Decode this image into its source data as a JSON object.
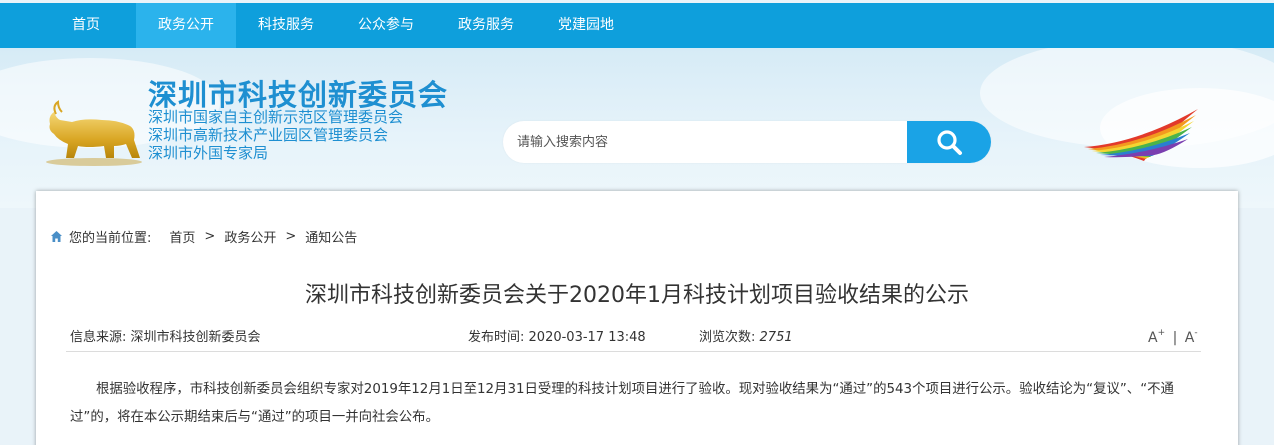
{
  "nav": {
    "items": [
      {
        "label": "首页",
        "active": false
      },
      {
        "label": "政务公开",
        "active": true
      },
      {
        "label": "科技服务",
        "active": false
      },
      {
        "label": "公众参与",
        "active": false
      },
      {
        "label": "政务服务",
        "active": false
      },
      {
        "label": "党建园地",
        "active": false
      }
    ]
  },
  "header": {
    "org_name": "深圳市科技创新委员会",
    "sub_names": [
      "深圳市国家自主创新示范区管理委员会",
      "深圳市高新技术产业园区管理委员会",
      "深圳市外国专家局"
    ]
  },
  "search": {
    "placeholder": "请输入搜索内容",
    "value": ""
  },
  "breadcrumb": {
    "prefix": "您的当前位置:",
    "items": [
      "首页",
      "政务公开",
      "通知公告"
    ],
    "separator": ">"
  },
  "article": {
    "title": "深圳市科技创新委员会关于2020年1月科技计划项目验收结果的公示",
    "source_label": "信息来源:",
    "source_value": "深圳市科技创新委员会",
    "publish_label": "发布时间:",
    "publish_value": "2020-03-17 13:48",
    "views_label": "浏览次数:",
    "views_value": "2751",
    "font_larger": "A",
    "font_smaller": "A",
    "font_larger_sup": "+",
    "font_smaller_sup": "-",
    "font_divider": "|",
    "paragraph": "根据验收程序，市科技创新委员会组织专家对2019年12月1日至12月31日受理的科技计划项目进行了验收。现对验收结果为“通过”的543个项目进行公示。验收结论为“复议”、“不通过”的，将在本公示期结束后与“通过”的项目一并向社会公布。"
  },
  "colors": {
    "nav_bg": "#0e9fdc",
    "nav_active": "#2bb3ec",
    "brand_blue": "#1e8fd1",
    "search_btn": "#1aa3e6"
  },
  "icons": {
    "search": "search-icon",
    "home": "home-icon",
    "logo": "golden-bull-logo",
    "emblem": "rainbow-wing-logo"
  }
}
